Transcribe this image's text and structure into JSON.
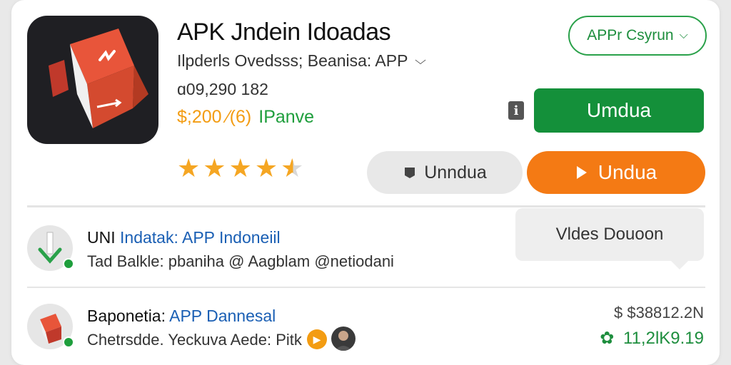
{
  "app": {
    "title": "APK Jndein Idoadas",
    "subtitle": "Ilpderls Ovedsss; Beanisa:  APP",
    "count": "ɑ09,290 182",
    "price": "$;200 ⁄(6)",
    "price_tag": "IPanve",
    "rating": 4.5
  },
  "top_right": {
    "select_label": "APPr Csyrun"
  },
  "buttons": {
    "primary_green": "Umdua",
    "grey": "Unndua",
    "orange": "Undua"
  },
  "tooltip": {
    "text": "Vldes Douoon"
  },
  "list": {
    "row1": {
      "title_prefix": "UNI",
      "title_link": "Indatak: APP Indoneiil",
      "subtitle": "Tad Balkle: pbaniha @ Aagblam @netiodani"
    },
    "row2": {
      "title_prefix": "Baponetia:",
      "title_link": "APP Dannesal",
      "subtitle": "Chetrsdde. Yeckuva Aede: Pitk",
      "amount_top": "$ $38812.2N",
      "amount_bottom": "11,2lK9.19"
    }
  },
  "colors": {
    "accent_green": "#14903a",
    "accent_orange": "#f47a14",
    "star": "#f5a623",
    "link_blue": "#1a5fb4"
  }
}
